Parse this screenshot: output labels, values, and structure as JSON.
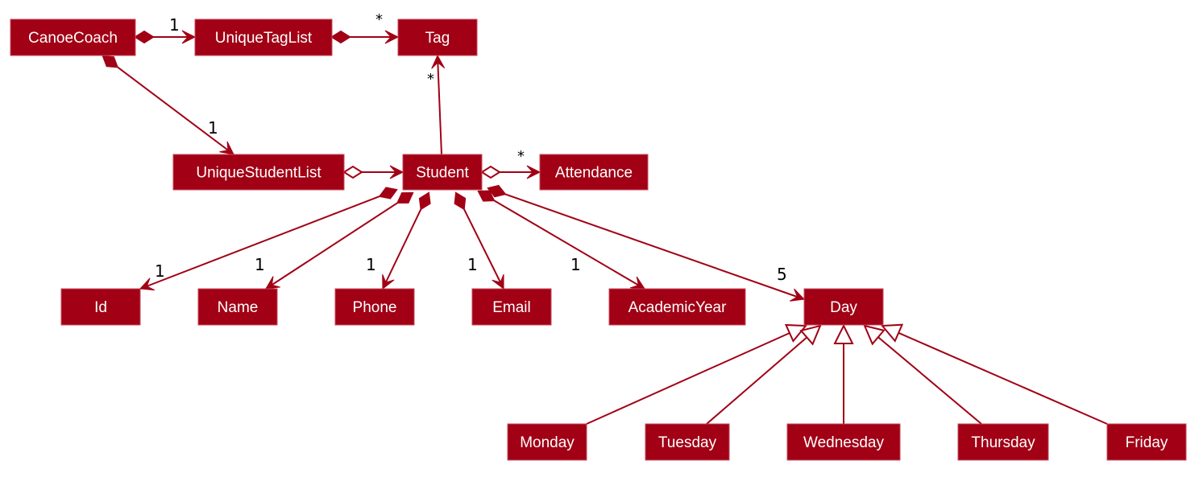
{
  "diagram": {
    "type": "UML class diagram",
    "colors": {
      "class_fill": "#A10015",
      "class_text": "#FFFFFF",
      "edge": "#A10015",
      "multiplicity_text": "#000000"
    },
    "classes": [
      {
        "id": "CanoeCoach",
        "label": "CanoeCoach"
      },
      {
        "id": "UniqueTagList",
        "label": "UniqueTagList"
      },
      {
        "id": "Tag",
        "label": "Tag"
      },
      {
        "id": "UniqueStudentList",
        "label": "UniqueStudentList"
      },
      {
        "id": "Student",
        "label": "Student"
      },
      {
        "id": "Attendance",
        "label": "Attendance"
      },
      {
        "id": "Id",
        "label": "Id"
      },
      {
        "id": "Name",
        "label": "Name"
      },
      {
        "id": "Phone",
        "label": "Phone"
      },
      {
        "id": "Email",
        "label": "Email"
      },
      {
        "id": "AcademicYear",
        "label": "AcademicYear"
      },
      {
        "id": "Day",
        "label": "Day"
      },
      {
        "id": "Monday",
        "label": "Monday"
      },
      {
        "id": "Tuesday",
        "label": "Tuesday"
      },
      {
        "id": "Wednesday",
        "label": "Wednesday"
      },
      {
        "id": "Thursday",
        "label": "Thursday"
      },
      {
        "id": "Friday",
        "label": "Friday"
      }
    ],
    "relationships": [
      {
        "from": "CanoeCoach",
        "to": "UniqueTagList",
        "kind": "composition",
        "multiplicity": "1"
      },
      {
        "from": "UniqueTagList",
        "to": "Tag",
        "kind": "composition",
        "multiplicity": "*"
      },
      {
        "from": "CanoeCoach",
        "to": "UniqueStudentList",
        "kind": "composition",
        "multiplicity": "1"
      },
      {
        "from": "Student",
        "to": "Tag",
        "kind": "association",
        "multiplicity": "*"
      },
      {
        "from": "UniqueStudentList",
        "to": "Student",
        "kind": "aggregation",
        "multiplicity": ""
      },
      {
        "from": "Student",
        "to": "Attendance",
        "kind": "aggregation",
        "multiplicity": "*"
      },
      {
        "from": "Student",
        "to": "Id",
        "kind": "composition",
        "multiplicity": "1"
      },
      {
        "from": "Student",
        "to": "Name",
        "kind": "composition",
        "multiplicity": "1"
      },
      {
        "from": "Student",
        "to": "Phone",
        "kind": "composition",
        "multiplicity": "1"
      },
      {
        "from": "Student",
        "to": "Email",
        "kind": "composition",
        "multiplicity": "1"
      },
      {
        "from": "Student",
        "to": "AcademicYear",
        "kind": "composition",
        "multiplicity": "1"
      },
      {
        "from": "Student",
        "to": "Day",
        "kind": "composition",
        "multiplicity": "5"
      },
      {
        "from": "Monday",
        "to": "Day",
        "kind": "generalization",
        "multiplicity": ""
      },
      {
        "from": "Tuesday",
        "to": "Day",
        "kind": "generalization",
        "multiplicity": ""
      },
      {
        "from": "Wednesday",
        "to": "Day",
        "kind": "generalization",
        "multiplicity": ""
      },
      {
        "from": "Thursday",
        "to": "Day",
        "kind": "generalization",
        "multiplicity": ""
      },
      {
        "from": "Friday",
        "to": "Day",
        "kind": "generalization",
        "multiplicity": ""
      }
    ]
  }
}
